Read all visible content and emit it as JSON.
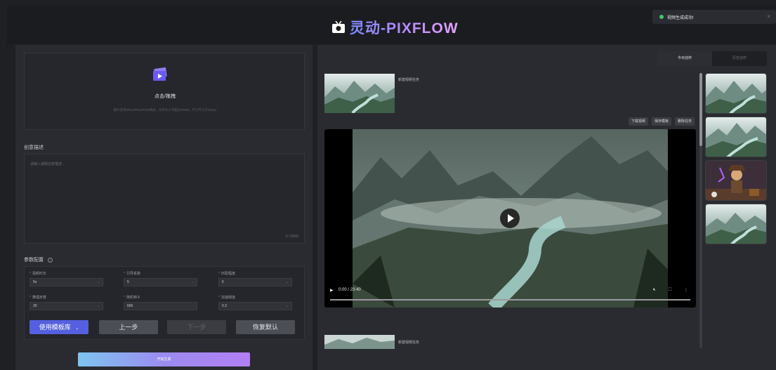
{
  "header": {
    "title": "灵动-PIXFLOW"
  },
  "toast": {
    "message": "视频生成成功!",
    "close": "×",
    "color": "#3ec76a"
  },
  "upload": {
    "title": "点击/拖拽",
    "hint": "图片支持JPG/JPEG/PNG格式，文件大小不超过20MB，尺寸不小于300px"
  },
  "prompt": {
    "title": "创意描述",
    "placeholder": "请输入视频创意描述...",
    "count": "0 / 5000"
  },
  "params": {
    "title": "参数配置",
    "fields": [
      {
        "label": "视频时长",
        "value": "5s"
      },
      {
        "label": "引导系数",
        "value": "5"
      },
      {
        "label": "匹配程度",
        "value": "6"
      },
      {
        "label": "推理步数",
        "value": "30"
      },
      {
        "label": "随机种子",
        "value": "666"
      },
      {
        "label": "加速阈值",
        "value": "0.3"
      }
    ]
  },
  "buttons": {
    "template": "使用模板库",
    "prev": "上一步",
    "next": "下一步",
    "reset": "恢复默认",
    "start": "开始生成"
  },
  "tabs": {
    "today": "今日创作",
    "history": "历史创作"
  },
  "tasks": {
    "task1_title": "新建视频任务",
    "task2_title": "新建视频任务"
  },
  "actions": {
    "download": "下载视频",
    "save_template": "保存模板",
    "delete_task": "删除任务"
  },
  "player": {
    "time": "0:00 / 23:40"
  },
  "colors": {
    "accent": "#5560e0",
    "background": "#1f2024",
    "panel": "#2a2b30"
  }
}
